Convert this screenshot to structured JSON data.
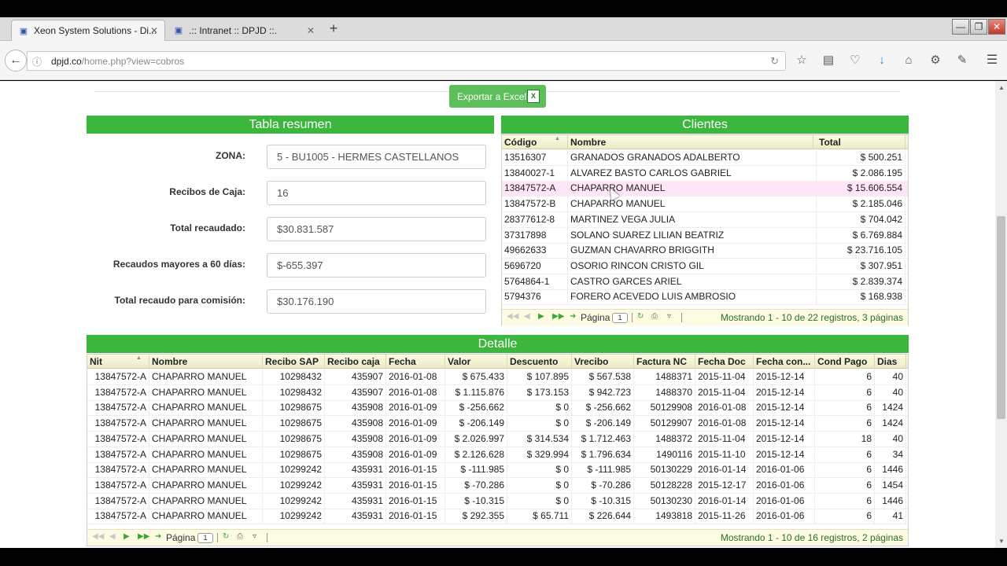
{
  "browser": {
    "tabs": [
      {
        "title": "Xeon System Solutions - Di...",
        "active": true
      },
      {
        "title": ".:: Intranet :: DPJD ::.",
        "active": false
      }
    ],
    "url_host": "dpjd.co",
    "url_path": "/home.php?view=cobros",
    "new_tab_label": "+",
    "toolbar_icons": [
      "star-icon",
      "reading-list-icon",
      "pocket-icon",
      "download-icon",
      "home-icon",
      "sync-icon",
      "extension-icon"
    ]
  },
  "page": {
    "export_label": "Exportar a Excel",
    "export_icon": "X",
    "summary": {
      "title": "Tabla resumen",
      "fields": [
        {
          "label": "ZONA:",
          "value": "5 - BU1005 - HERMES CASTELLANOS"
        },
        {
          "label": "Recibos de Caja:",
          "value": "16"
        },
        {
          "label": "Total recaudado:",
          "value": "$30.831.587"
        },
        {
          "label": "Recaudos mayores a 60 días:",
          "value": "$-655.397"
        },
        {
          "label": "Total recaudo para comisión:",
          "value": "$30.176.190"
        }
      ]
    },
    "clients": {
      "title": "Clientes",
      "columns": [
        "Código",
        "Nombre",
        "Total"
      ],
      "rows": [
        [
          "13516307",
          "GRANADOS GRANADOS ADALBERTO",
          "$ 500.251"
        ],
        [
          "13840027-1",
          "ALVAREZ BASTO CARLOS GABRIEL",
          "$ 2.086.195"
        ],
        [
          "13847572-A",
          "CHAPARRO MANUEL",
          "$ 15.606.554"
        ],
        [
          "13847572-B",
          "CHAPARRO MANUEL",
          "$ 2.185.046"
        ],
        [
          "28377612-8",
          "MARTINEZ VEGA JULIA",
          "$ 704.042"
        ],
        [
          "37317898",
          "SOLANO SUAREZ LILIAN BEATRIZ",
          "$ 6.769.884"
        ],
        [
          "49662633",
          "GUZMAN CHAVARRO BRIGGITH",
          "$ 23.716.105"
        ],
        [
          "5696720",
          "OSORIO RINCON CRISTO GIL",
          "$ 307.951"
        ],
        [
          "5764864-1",
          "CASTRO GARCES ARIEL",
          "$ 2.839.374"
        ],
        [
          "5794376",
          "FORERO ACEVEDO LUIS AMBROSIO",
          "$ 168.938"
        ]
      ],
      "highlighted_row": 2,
      "pager_label": "Página",
      "pager_page": "1",
      "pager_info": "Mostrando 1 - 10 de 22 registros, 3 páginas"
    },
    "detail": {
      "title": "Detalle",
      "columns": [
        "Nit",
        "Nombre",
        "Recibo SAP",
        "Recibo caja",
        "Fecha",
        "Valor",
        "Descuento",
        "Vrecibo",
        "Factura NC",
        "Fecha Doc",
        "Fecha con...",
        "Cond Pago",
        "Dias"
      ],
      "rows": [
        [
          "13847572-A",
          "CHAPARRO MANUEL",
          "10298432",
          "435907",
          "2016-01-08",
          "$ 675.433",
          "$ 107.895",
          "$ 567.538",
          "1488371",
          "2015-11-04",
          "2015-12-14",
          "6",
          "40"
        ],
        [
          "13847572-A",
          "CHAPARRO MANUEL",
          "10298432",
          "435907",
          "2016-01-08",
          "$ 1.115.876",
          "$ 173.153",
          "$ 942.723",
          "1488370",
          "2015-11-04",
          "2015-12-14",
          "6",
          "40"
        ],
        [
          "13847572-A",
          "CHAPARRO MANUEL",
          "10298675",
          "435908",
          "2016-01-09",
          "$ -256.662",
          "$ 0",
          "$ -256.662",
          "50129908",
          "2016-01-08",
          "2015-12-14",
          "6",
          "1424"
        ],
        [
          "13847572-A",
          "CHAPARRO MANUEL",
          "10298675",
          "435908",
          "2016-01-09",
          "$ -206.149",
          "$ 0",
          "$ -206.149",
          "50129907",
          "2016-01-08",
          "2015-12-14",
          "6",
          "1424"
        ],
        [
          "13847572-A",
          "CHAPARRO MANUEL",
          "10298675",
          "435908",
          "2016-01-09",
          "$ 2.026.997",
          "$ 314.534",
          "$ 1.712.463",
          "1488372",
          "2015-11-04",
          "2015-12-14",
          "18",
          "40"
        ],
        [
          "13847572-A",
          "CHAPARRO MANUEL",
          "10298675",
          "435908",
          "2016-01-09",
          "$ 2.126.628",
          "$ 329.994",
          "$ 1.796.634",
          "1490116",
          "2015-11-10",
          "2015-12-14",
          "6",
          "34"
        ],
        [
          "13847572-A",
          "CHAPARRO MANUEL",
          "10299242",
          "435931",
          "2016-01-15",
          "$ -111.985",
          "$ 0",
          "$ -111.985",
          "50130229",
          "2016-01-14",
          "2016-01-06",
          "6",
          "1446"
        ],
        [
          "13847572-A",
          "CHAPARRO MANUEL",
          "10299242",
          "435931",
          "2016-01-15",
          "$ -70.286",
          "$ 0",
          "$ -70.286",
          "50128228",
          "2015-12-17",
          "2016-01-06",
          "6",
          "1454"
        ],
        [
          "13847572-A",
          "CHAPARRO MANUEL",
          "10299242",
          "435931",
          "2016-01-15",
          "$ -10.315",
          "$ 0",
          "$ -10.315",
          "50130230",
          "2016-01-14",
          "2016-01-06",
          "6",
          "1446"
        ],
        [
          "13847572-A",
          "CHAPARRO MANUEL",
          "10299242",
          "435931",
          "2016-01-15",
          "$ 292.355",
          "$ 65.711",
          "$ 226.644",
          "1493818",
          "2015-11-26",
          "2016-01-06",
          "6",
          "41"
        ]
      ],
      "pager_label": "Página",
      "pager_page": "1",
      "pager_info": "Mostrando 1 - 10 de 16 registros, 2 páginas"
    }
  }
}
